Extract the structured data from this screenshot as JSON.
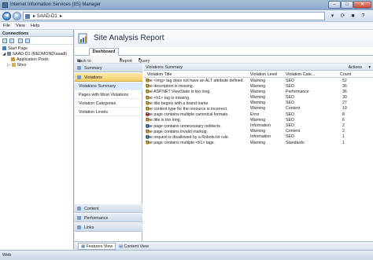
{
  "window": {
    "title": "Internet Information Services (IIS) Manager"
  },
  "address": {
    "path": "SAAD-D1",
    "arrow": "▸"
  },
  "menu": [
    "File",
    "View",
    "Help"
  ],
  "connections": {
    "title": "Connections",
    "tree": [
      {
        "label": "Start Page",
        "indent": 0
      },
      {
        "label": "SAAD-D1 (REDMOND\\saadl)",
        "indent": 0
      },
      {
        "label": "Application Pools",
        "indent": 1
      },
      {
        "label": "Sites",
        "indent": 1
      }
    ]
  },
  "page": {
    "title": "Site Analysis Report",
    "tab": "Dashboard",
    "back": "Back to Reports",
    "report_menu": "Report",
    "query_menu": "Query"
  },
  "nav": {
    "summary": "Summary",
    "violations": "Violations",
    "items": [
      "Violations Summary",
      "Pages with Most Violations",
      "Violation Categories",
      "Violation Levels"
    ],
    "content": "Content",
    "performance": "Performance",
    "links": "Links"
  },
  "report": {
    "title": "Violations Summary",
    "actions": "Actions",
    "columns": [
      "Violation Title",
      "Violation Level",
      "Violation Cate...",
      "Count"
    ],
    "rows": [
      {
        "title": "The <img> tag does not have an ALT attribute defined.",
        "level": "Warning",
        "category": "SEO",
        "count": "52"
      },
      {
        "title": "The description is missing.",
        "level": "Warning",
        "category": "SEO",
        "count": "36"
      },
      {
        "title": "The ASP.NET ViewState is too long.",
        "level": "Warning",
        "category": "Performance",
        "count": "36"
      },
      {
        "title": "The <h1> tag is missing.",
        "level": "Warning",
        "category": "SEO",
        "count": "30"
      },
      {
        "title": "The title begins with a brand name.",
        "level": "Warning",
        "category": "SEO",
        "count": "27"
      },
      {
        "title": "The content type for the resource is incorrect.",
        "level": "Warning",
        "category": "Content",
        "count": "19"
      },
      {
        "title": "The page contains multiple canonical formats.",
        "level": "Error",
        "category": "SEO",
        "count": "8"
      },
      {
        "title": "The title is too long.",
        "level": "Warning",
        "category": "SEO",
        "count": "6"
      },
      {
        "title": "The page contains unnecessary redirects.",
        "level": "Information",
        "category": "SEO",
        "count": "2"
      },
      {
        "title": "The page contains invalid markup.",
        "level": "Warning",
        "category": "Content",
        "count": "2"
      },
      {
        "title": "The request is disallowed by a Robots.txt rule.",
        "level": "Information",
        "category": "SEO",
        "count": "1"
      },
      {
        "title": "The page contains multiple <h1> tags.",
        "level": "Warning",
        "category": "Standards",
        "count": "1"
      }
    ]
  },
  "bottom_tabs": [
    "Features View",
    "Content View"
  ],
  "status": "Web",
  "colors": {
    "warning": "#e2a400",
    "error": "#c8231b",
    "information": "#2f6db8",
    "selected": "#f4cf6b"
  }
}
